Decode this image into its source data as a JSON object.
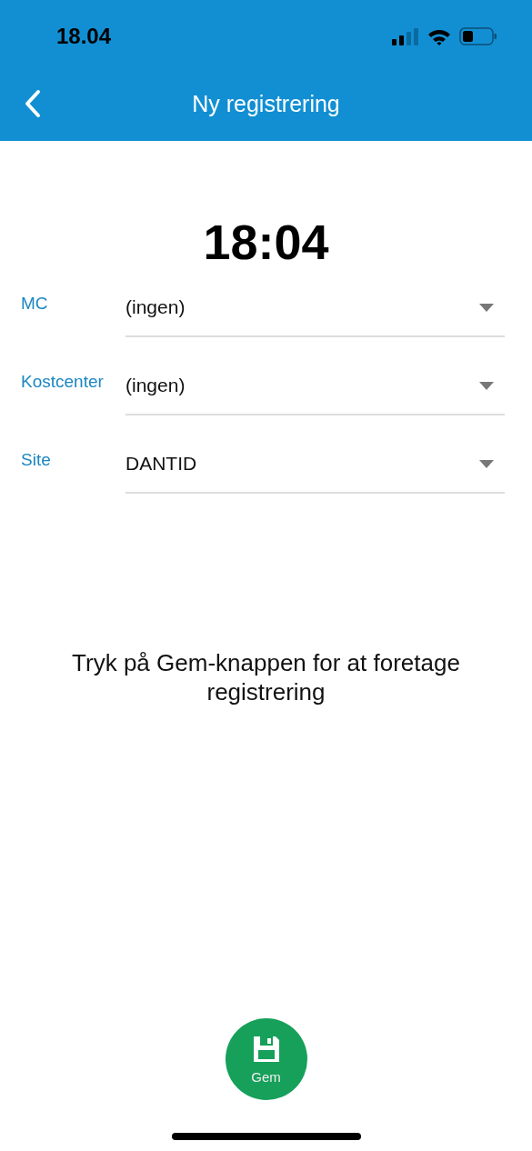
{
  "status_bar": {
    "time": "18.04"
  },
  "header": {
    "title": "Ny registrering"
  },
  "clock": "18:04",
  "fields": [
    {
      "label": "MC",
      "value": "(ingen)"
    },
    {
      "label": "Kostcenter",
      "value": "(ingen)"
    },
    {
      "label": "Site",
      "value": "DANTID"
    }
  ],
  "message": "Tryk på Gem-knappen for at foretage registrering",
  "save_button": {
    "label": "Gem"
  }
}
